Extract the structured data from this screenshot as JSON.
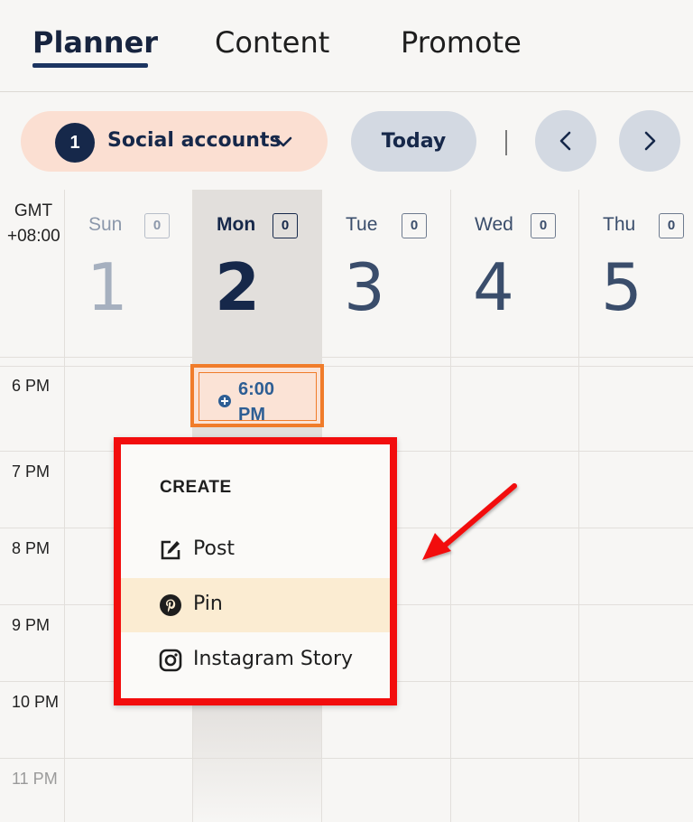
{
  "tabs": [
    {
      "label": "Planner",
      "active": true
    },
    {
      "label": "Content",
      "active": false
    },
    {
      "label": "Promote",
      "active": false
    }
  ],
  "toolbar": {
    "accounts_count": "1",
    "accounts_label": "Social accounts",
    "today_label": "Today",
    "prev_icon": "chevron-left-icon",
    "next_icon": "chevron-right-icon"
  },
  "calendar": {
    "timezone_line1": "GMT",
    "timezone_line2": "+08:00",
    "days": [
      {
        "name": "Sun",
        "number": "1",
        "count": "0",
        "state": "past"
      },
      {
        "name": "Mon",
        "number": "2",
        "count": "0",
        "state": "current"
      },
      {
        "name": "Tue",
        "number": "3",
        "count": "0",
        "state": "future"
      },
      {
        "name": "Wed",
        "number": "4",
        "count": "0",
        "state": "future"
      },
      {
        "name": "Thu",
        "number": "5",
        "count": "0",
        "state": "future"
      }
    ],
    "times": [
      "6 PM",
      "7 PM",
      "8 PM",
      "9 PM",
      "10 PM",
      "11 PM"
    ],
    "new_slot": {
      "line1": "6:00",
      "line2": "PM"
    }
  },
  "create_menu": {
    "title": "CREATE",
    "items": [
      {
        "label": "Post",
        "icon": "edit-icon",
        "highlighted": false
      },
      {
        "label": "Pin",
        "icon": "pinterest-icon",
        "highlighted": true
      },
      {
        "label": "Instagram Story",
        "icon": "instagram-icon",
        "highlighted": false
      }
    ]
  },
  "colors": {
    "accent_red": "#f20d0d",
    "slot_orange": "#f07c2a",
    "navy": "#16284a",
    "accounts_bg": "#fbdfd2",
    "highlight_bg": "#fbecd2"
  }
}
